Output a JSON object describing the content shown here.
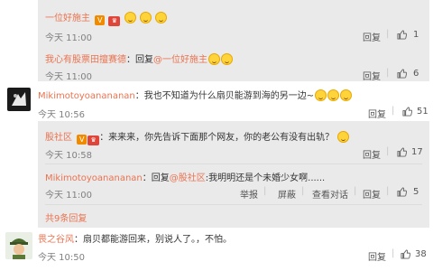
{
  "top_block": {
    "row1": {
      "user": "一位好施主",
      "time": "今天 11:00",
      "reply": "回复",
      "likes": "1"
    },
    "row2": {
      "user": "我心有股票田擅赛德",
      "sep": "：回复",
      "mention": "@一位好施主",
      "time": "今天 11:00",
      "reply": "回复",
      "likes": "6"
    }
  },
  "comment1": {
    "user": "Mikimotoyoanananan",
    "text": "：我也不知道为什么扇贝能游到海的另一边~",
    "time": "今天 10:56",
    "reply": "回复",
    "likes": "51"
  },
  "thread1": {
    "r1": {
      "user": "股社区",
      "text": "：来来来，你先告诉下面那个网友，你的老公有没有出轨？",
      "time": "今天 10:58",
      "reply": "回复",
      "likes": "17"
    },
    "r2": {
      "user": "Mikimotoyoanananan",
      "text_pre": "：回复",
      "mention": "@股社区",
      "text": ":我明明还是个未婚少女啊......",
      "time": "今天 11:00",
      "actions": [
        "举报",
        "屏蔽",
        "查看对话",
        "回复"
      ],
      "likes": "5"
    },
    "more": "共9条回复"
  },
  "comment2": {
    "user": "畏之谷风",
    "text": "：扇贝都能游回来，别说人了。，不怕。",
    "time": "今天 10:50",
    "reply": "回复",
    "likes": "38"
  },
  "colors": {
    "username": "#eb7350",
    "nested_bg": "#eaeaea",
    "badge_orange": "#f08b00"
  }
}
